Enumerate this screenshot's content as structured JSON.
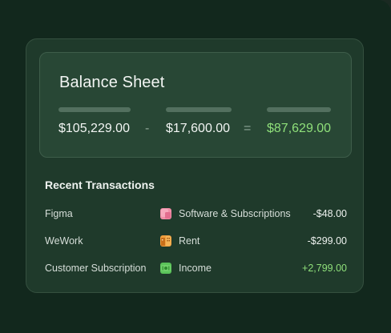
{
  "balance": {
    "title": "Balance Sheet",
    "assets": "$105,229.00",
    "minus_sign": "-",
    "liabilities": "$17,600.00",
    "equals_sign": "=",
    "equity": "$87,629.00",
    "colors": {
      "equity": "#8fe07a"
    }
  },
  "transactions": {
    "title": "Recent Transactions",
    "items": [
      {
        "name": "Figma",
        "category": "Software & Subscriptions",
        "category_icon": "software-icon",
        "amount": "-$48.00"
      },
      {
        "name": "WeWork",
        "category": "Rent",
        "category_icon": "building-icon",
        "amount": "-$299.00"
      },
      {
        "name": "Customer Subscription",
        "category": "Income",
        "category_icon": "cash-icon",
        "amount": "+2,799.00"
      }
    ]
  }
}
